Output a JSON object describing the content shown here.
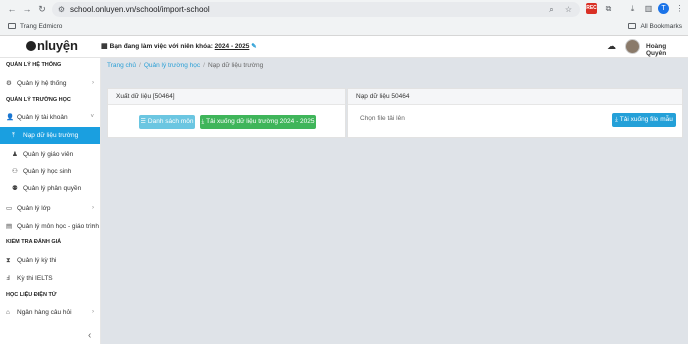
{
  "browser": {
    "url": "school.onluyen.vn/school/import-school",
    "bookmark_left": "Trang Edmicro",
    "bookmark_right": "All Bookmarks",
    "profile_initial": "T",
    "ext_badge": "REC"
  },
  "header": {
    "logo_text": "nluyện",
    "year_prefix": "Bạn đang làm việc với niên khóa:",
    "year_value": "2024 - 2025",
    "user_name": "Hoàng Quyên"
  },
  "sidebar": {
    "sections": {
      "system": "QUẢN LÝ HỆ THỐNG",
      "school": "QUẢN LÝ TRƯỜNG HỌC",
      "exam": "KIỂM TRA ĐÁNH GIÁ",
      "digital": "HỌC LIỆU ĐIỆN TỬ"
    },
    "items": {
      "system_mgmt": "Quản lý hệ thống",
      "account_mgmt": "Quản lý tài khoản",
      "import_data": "Nạp dữ liệu trường",
      "teacher_mgmt": "Quản lý giáo viên",
      "student_mgmt": "Quản lý học sinh",
      "role_mgmt": "Quản lý phân quyền",
      "class_mgmt": "Quản lý lớp",
      "subject_mgmt": "Quản lý môn học - giáo trình",
      "exam_mgmt": "Quản lý kỳ thi",
      "ielts": "Kỳ thi IELTS",
      "question_bank": "Ngân hàng câu hỏi"
    }
  },
  "breadcrumb": {
    "home": "Trang chủ",
    "school": "Quản lý trường học",
    "current": "Nạp dữ liệu trường"
  },
  "export_card": {
    "title": "Xuất dữ liệu [50464]",
    "subjects_button": "Danh sách môn",
    "download_button": "Tải xuống dữ liệu trường 2024 - 2025"
  },
  "import_card": {
    "title": "Nạp dữ liệu 50464",
    "file_placeholder": "Chọn file tải lên",
    "template_button": "Tải xuống file mẫu"
  }
}
